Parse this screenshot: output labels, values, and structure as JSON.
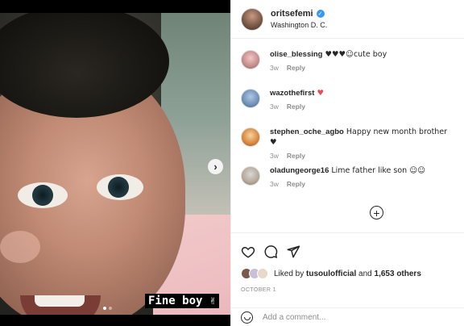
{
  "post": {
    "username": "oritsefemi",
    "location": "Washington D. C.",
    "caption_overlay": "Fine boy ✌",
    "date": "OCTOBER 1"
  },
  "comments": [
    {
      "user": "olise_blessing",
      "text": "♥♥♥☺cute boy",
      "time": "3w",
      "reply": "Reply"
    },
    {
      "user": "wazothefirst",
      "text": "♥",
      "time": "3w",
      "reply": "Reply"
    },
    {
      "user": "stephen_oche_agbo",
      "text": "Happy new month brother ♥",
      "time": "3w",
      "reply": "Reply"
    },
    {
      "user": "oladungeorge16",
      "text": "Lime father like son ☺☺",
      "time": "3w",
      "reply": "Reply"
    }
  ],
  "likes": {
    "prefix": "Liked by",
    "user": "tusoulofficial",
    "conjunction": "and",
    "others": "1,653 others"
  },
  "comment_box": {
    "placeholder": "Add a comment..."
  },
  "icons": {
    "like": "heart-icon",
    "comment": "comment-icon",
    "share": "share-icon",
    "next": "chevron-right-icon",
    "emoji": "emoji-icon",
    "load_more": "plus-circle-icon"
  },
  "colors": {
    "verified": "#3897f0",
    "heart": "#ed4956",
    "muted": "#8e8e8e"
  }
}
